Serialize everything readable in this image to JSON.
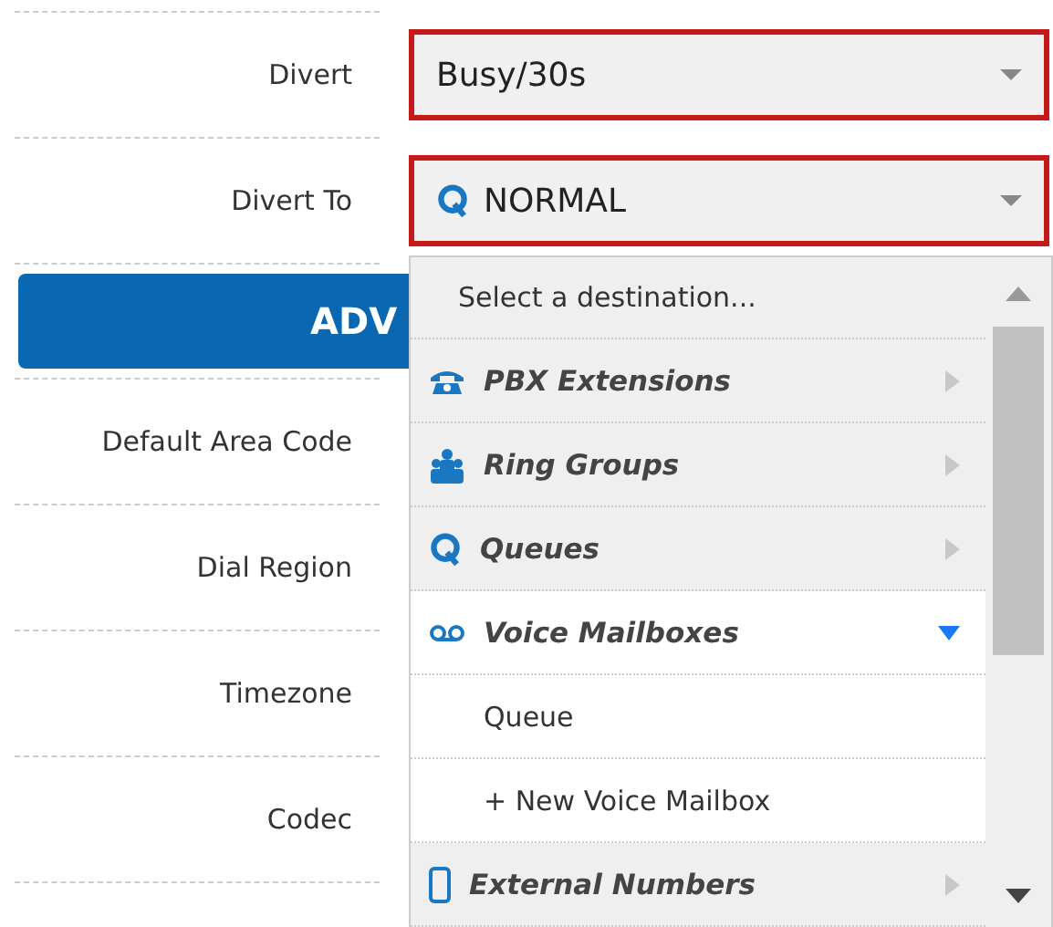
{
  "form": {
    "rows": [
      {
        "label": "Divert",
        "value": "Busy/30s",
        "kind": "plain",
        "invalid": true
      },
      {
        "label": "Divert To",
        "value": "NORMAL",
        "kind": "queue",
        "invalid": true
      }
    ],
    "advanced_button": {
      "label": "ADV"
    },
    "more_rows": [
      {
        "label": "Default Area Code"
      },
      {
        "label": "Dial Region"
      },
      {
        "label": "Timezone"
      },
      {
        "label": "Codec"
      }
    ]
  },
  "dropdown": {
    "prompt": "Select a destination...",
    "groups": [
      {
        "label": "PBX Extensions",
        "kind": "phone",
        "expanded": false
      },
      {
        "label": "Ring Groups",
        "kind": "group",
        "expanded": false
      },
      {
        "label": "Queues",
        "kind": "queue",
        "expanded": false
      },
      {
        "label": "Voice Mailboxes",
        "kind": "voicemail",
        "expanded": true,
        "children": [
          {
            "label": "Queue"
          },
          {
            "label": "+ New Voice Mailbox"
          }
        ]
      },
      {
        "label": "External Numbers",
        "kind": "mobile",
        "expanded": false
      }
    ]
  }
}
